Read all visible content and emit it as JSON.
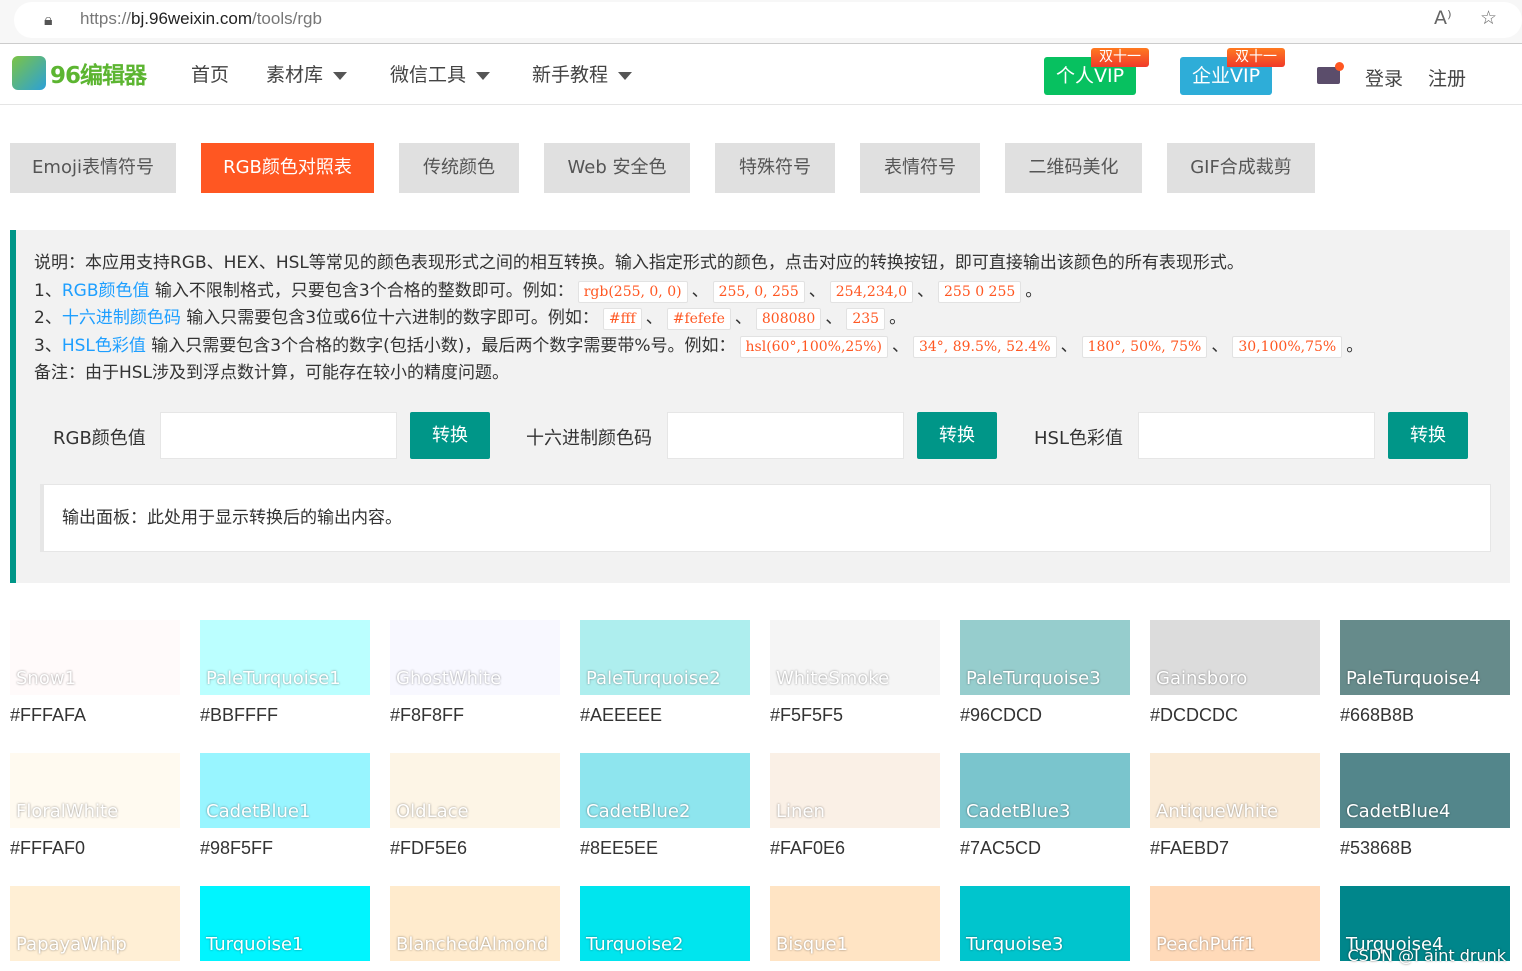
{
  "browser": {
    "url_host_prefix": "https://",
    "url_host": "bj.96weixin.com",
    "url_path": "/tools/rgb",
    "read_aloud_icon": "A⁾",
    "favorite_icon": "☆"
  },
  "nav": {
    "logo": "96编辑器",
    "items": [
      {
        "label": "首页",
        "dropdown": false
      },
      {
        "label": "素材库",
        "dropdown": true
      },
      {
        "label": "微信工具",
        "dropdown": true
      },
      {
        "label": "新手教程",
        "dropdown": true
      }
    ],
    "vip_personal": "个人VIP",
    "vip_enterprise": "企业VIP",
    "badge": "双十一",
    "login": "登录",
    "register": "注册",
    "colors": {
      "personal": "#07c160",
      "enterprise": "#2eadd8"
    }
  },
  "tabs": [
    {
      "label": "Emoji表情符号"
    },
    {
      "label": "RGB颜色对照表",
      "active": true
    },
    {
      "label": "传统颜色"
    },
    {
      "label": "Web 安全色"
    },
    {
      "label": "特殊符号"
    },
    {
      "label": "表情符号"
    },
    {
      "label": "二维码美化"
    },
    {
      "label": "GIF合成裁剪"
    }
  ],
  "desc": {
    "intro": "说明：本应用支持RGB、HEX、HSL等常见的颜色表现形式之间的相互转换。输入指定形式的颜色，点击对应的转换按钮，即可直接输出该颜色的所有表现形式。",
    "l1_pre": "1、",
    "l1_link": "RGB颜色值",
    "l1_text": " 输入不限制格式，只要包含3个合格的整数即可。例如：",
    "l1_codes": [
      "rgb(255, 0, 0)",
      "255, 0, 255",
      "254,234,0",
      "255 0 255"
    ],
    "l2_pre": "2、",
    "l2_link": "十六进制颜色码",
    "l2_text": " 输入只需要包含3位或6位十六进制的数字即可。例如：",
    "l2_codes": [
      "#fff",
      "#fefefe",
      "808080",
      "235"
    ],
    "l3_pre": "3、",
    "l3_link": "HSL色彩值",
    "l3_text": " 输入只需要包含3个合格的数字(包括小数)，最后两个数字需要带%号。例如：",
    "l3_codes": [
      "hsl(60°,100%,25%)",
      "34°, 89.5%, 52.4%",
      "180°, 50%, 75%",
      "30,100%,75%"
    ],
    "sep": "、",
    "end": "。",
    "note": "备注：由于HSL涉及到浮点数计算，可能存在较小的精度问题。"
  },
  "form": {
    "rgb_label": "RGB颜色值",
    "hex_label": "十六进制颜色码",
    "hsl_label": "HSL色彩值",
    "convert": "转换",
    "rgb_value": "",
    "hex_value": "",
    "hsl_value": ""
  },
  "output": "输出面板：此处用于显示转换后的输出内容。",
  "swatches": [
    {
      "name": "Snow1",
      "hex": "#FFFAFA",
      "color": "#FFFAFA"
    },
    {
      "name": "PaleTurquoise1",
      "hex": "#BBFFFF",
      "color": "#BBFFFF"
    },
    {
      "name": "GhostWhite",
      "hex": "#F8F8FF",
      "color": "#F8F8FF"
    },
    {
      "name": "PaleTurquoise2",
      "hex": "#AEEEEE",
      "color": "#AEEEEE"
    },
    {
      "name": "WhiteSmoke",
      "hex": "#F5F5F5",
      "color": "#F5F5F5"
    },
    {
      "name": "PaleTurquoise3",
      "hex": "#96CDCD",
      "color": "#96CDCD"
    },
    {
      "name": "Gainsboro",
      "hex": "#DCDCDC",
      "color": "#DCDCDC"
    },
    {
      "name": "PaleTurquoise4",
      "hex": "#668B8B",
      "color": "#668B8B"
    },
    {
      "name": "FloralWhite",
      "hex": "#FFFAF0",
      "color": "#FFFAF0"
    },
    {
      "name": "CadetBlue1",
      "hex": "#98F5FF",
      "color": "#98F5FF"
    },
    {
      "name": "OldLace",
      "hex": "#FDF5E6",
      "color": "#FDF5E6"
    },
    {
      "name": "CadetBlue2",
      "hex": "#8EE5EE",
      "color": "#8EE5EE"
    },
    {
      "name": "Linen",
      "hex": "#FAF0E6",
      "color": "#FAF0E6"
    },
    {
      "name": "CadetBlue3",
      "hex": "#7AC5CD",
      "color": "#7AC5CD"
    },
    {
      "name": "AntiqueWhite",
      "hex": "#FAEBD7",
      "color": "#FAEBD7"
    },
    {
      "name": "CadetBlue4",
      "hex": "#53868B",
      "color": "#53868B"
    },
    {
      "name": "PapayaWhip",
      "color": "#FFEFD5"
    },
    {
      "name": "Turquoise1",
      "color": "#00F5FF"
    },
    {
      "name": "BlanchedAlmond",
      "color": "#FFEBCD"
    },
    {
      "name": "Turquoise2",
      "color": "#00E5EE"
    },
    {
      "name": "Bisque1",
      "color": "#FFE4C4"
    },
    {
      "name": "Turquoise3",
      "color": "#00C5CD"
    },
    {
      "name": "PeachPuff1",
      "color": "#FFDAB9"
    },
    {
      "name": "Turquoise4",
      "color": "#00868B"
    }
  ],
  "watermark": "CSDN @I aint drunk"
}
